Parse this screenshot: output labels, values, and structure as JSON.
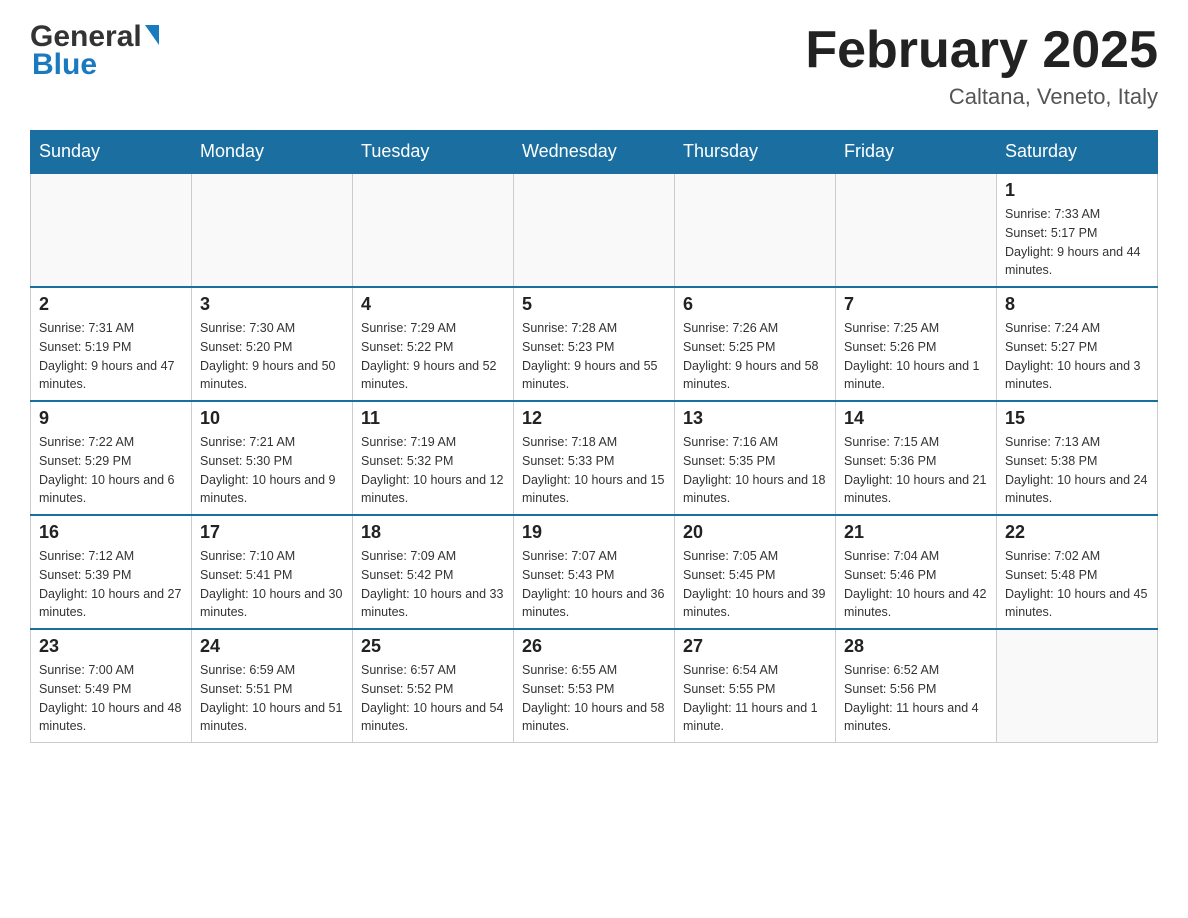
{
  "header": {
    "logo_general": "General",
    "logo_blue": "Blue",
    "month_title": "February 2025",
    "location": "Caltana, Veneto, Italy"
  },
  "days_of_week": [
    "Sunday",
    "Monday",
    "Tuesday",
    "Wednesday",
    "Thursday",
    "Friday",
    "Saturday"
  ],
  "weeks": [
    [
      {
        "day": "",
        "info": ""
      },
      {
        "day": "",
        "info": ""
      },
      {
        "day": "",
        "info": ""
      },
      {
        "day": "",
        "info": ""
      },
      {
        "day": "",
        "info": ""
      },
      {
        "day": "",
        "info": ""
      },
      {
        "day": "1",
        "info": "Sunrise: 7:33 AM\nSunset: 5:17 PM\nDaylight: 9 hours and 44 minutes."
      }
    ],
    [
      {
        "day": "2",
        "info": "Sunrise: 7:31 AM\nSunset: 5:19 PM\nDaylight: 9 hours and 47 minutes."
      },
      {
        "day": "3",
        "info": "Sunrise: 7:30 AM\nSunset: 5:20 PM\nDaylight: 9 hours and 50 minutes."
      },
      {
        "day": "4",
        "info": "Sunrise: 7:29 AM\nSunset: 5:22 PM\nDaylight: 9 hours and 52 minutes."
      },
      {
        "day": "5",
        "info": "Sunrise: 7:28 AM\nSunset: 5:23 PM\nDaylight: 9 hours and 55 minutes."
      },
      {
        "day": "6",
        "info": "Sunrise: 7:26 AM\nSunset: 5:25 PM\nDaylight: 9 hours and 58 minutes."
      },
      {
        "day": "7",
        "info": "Sunrise: 7:25 AM\nSunset: 5:26 PM\nDaylight: 10 hours and 1 minute."
      },
      {
        "day": "8",
        "info": "Sunrise: 7:24 AM\nSunset: 5:27 PM\nDaylight: 10 hours and 3 minutes."
      }
    ],
    [
      {
        "day": "9",
        "info": "Sunrise: 7:22 AM\nSunset: 5:29 PM\nDaylight: 10 hours and 6 minutes."
      },
      {
        "day": "10",
        "info": "Sunrise: 7:21 AM\nSunset: 5:30 PM\nDaylight: 10 hours and 9 minutes."
      },
      {
        "day": "11",
        "info": "Sunrise: 7:19 AM\nSunset: 5:32 PM\nDaylight: 10 hours and 12 minutes."
      },
      {
        "day": "12",
        "info": "Sunrise: 7:18 AM\nSunset: 5:33 PM\nDaylight: 10 hours and 15 minutes."
      },
      {
        "day": "13",
        "info": "Sunrise: 7:16 AM\nSunset: 5:35 PM\nDaylight: 10 hours and 18 minutes."
      },
      {
        "day": "14",
        "info": "Sunrise: 7:15 AM\nSunset: 5:36 PM\nDaylight: 10 hours and 21 minutes."
      },
      {
        "day": "15",
        "info": "Sunrise: 7:13 AM\nSunset: 5:38 PM\nDaylight: 10 hours and 24 minutes."
      }
    ],
    [
      {
        "day": "16",
        "info": "Sunrise: 7:12 AM\nSunset: 5:39 PM\nDaylight: 10 hours and 27 minutes."
      },
      {
        "day": "17",
        "info": "Sunrise: 7:10 AM\nSunset: 5:41 PM\nDaylight: 10 hours and 30 minutes."
      },
      {
        "day": "18",
        "info": "Sunrise: 7:09 AM\nSunset: 5:42 PM\nDaylight: 10 hours and 33 minutes."
      },
      {
        "day": "19",
        "info": "Sunrise: 7:07 AM\nSunset: 5:43 PM\nDaylight: 10 hours and 36 minutes."
      },
      {
        "day": "20",
        "info": "Sunrise: 7:05 AM\nSunset: 5:45 PM\nDaylight: 10 hours and 39 minutes."
      },
      {
        "day": "21",
        "info": "Sunrise: 7:04 AM\nSunset: 5:46 PM\nDaylight: 10 hours and 42 minutes."
      },
      {
        "day": "22",
        "info": "Sunrise: 7:02 AM\nSunset: 5:48 PM\nDaylight: 10 hours and 45 minutes."
      }
    ],
    [
      {
        "day": "23",
        "info": "Sunrise: 7:00 AM\nSunset: 5:49 PM\nDaylight: 10 hours and 48 minutes."
      },
      {
        "day": "24",
        "info": "Sunrise: 6:59 AM\nSunset: 5:51 PM\nDaylight: 10 hours and 51 minutes."
      },
      {
        "day": "25",
        "info": "Sunrise: 6:57 AM\nSunset: 5:52 PM\nDaylight: 10 hours and 54 minutes."
      },
      {
        "day": "26",
        "info": "Sunrise: 6:55 AM\nSunset: 5:53 PM\nDaylight: 10 hours and 58 minutes."
      },
      {
        "day": "27",
        "info": "Sunrise: 6:54 AM\nSunset: 5:55 PM\nDaylight: 11 hours and 1 minute."
      },
      {
        "day": "28",
        "info": "Sunrise: 6:52 AM\nSunset: 5:56 PM\nDaylight: 11 hours and 4 minutes."
      },
      {
        "day": "",
        "info": ""
      }
    ]
  ],
  "colors": {
    "header_bg": "#1a6fa0",
    "header_text": "#ffffff",
    "border": "#1a6fa0",
    "logo_blue": "#1a7abf"
  }
}
